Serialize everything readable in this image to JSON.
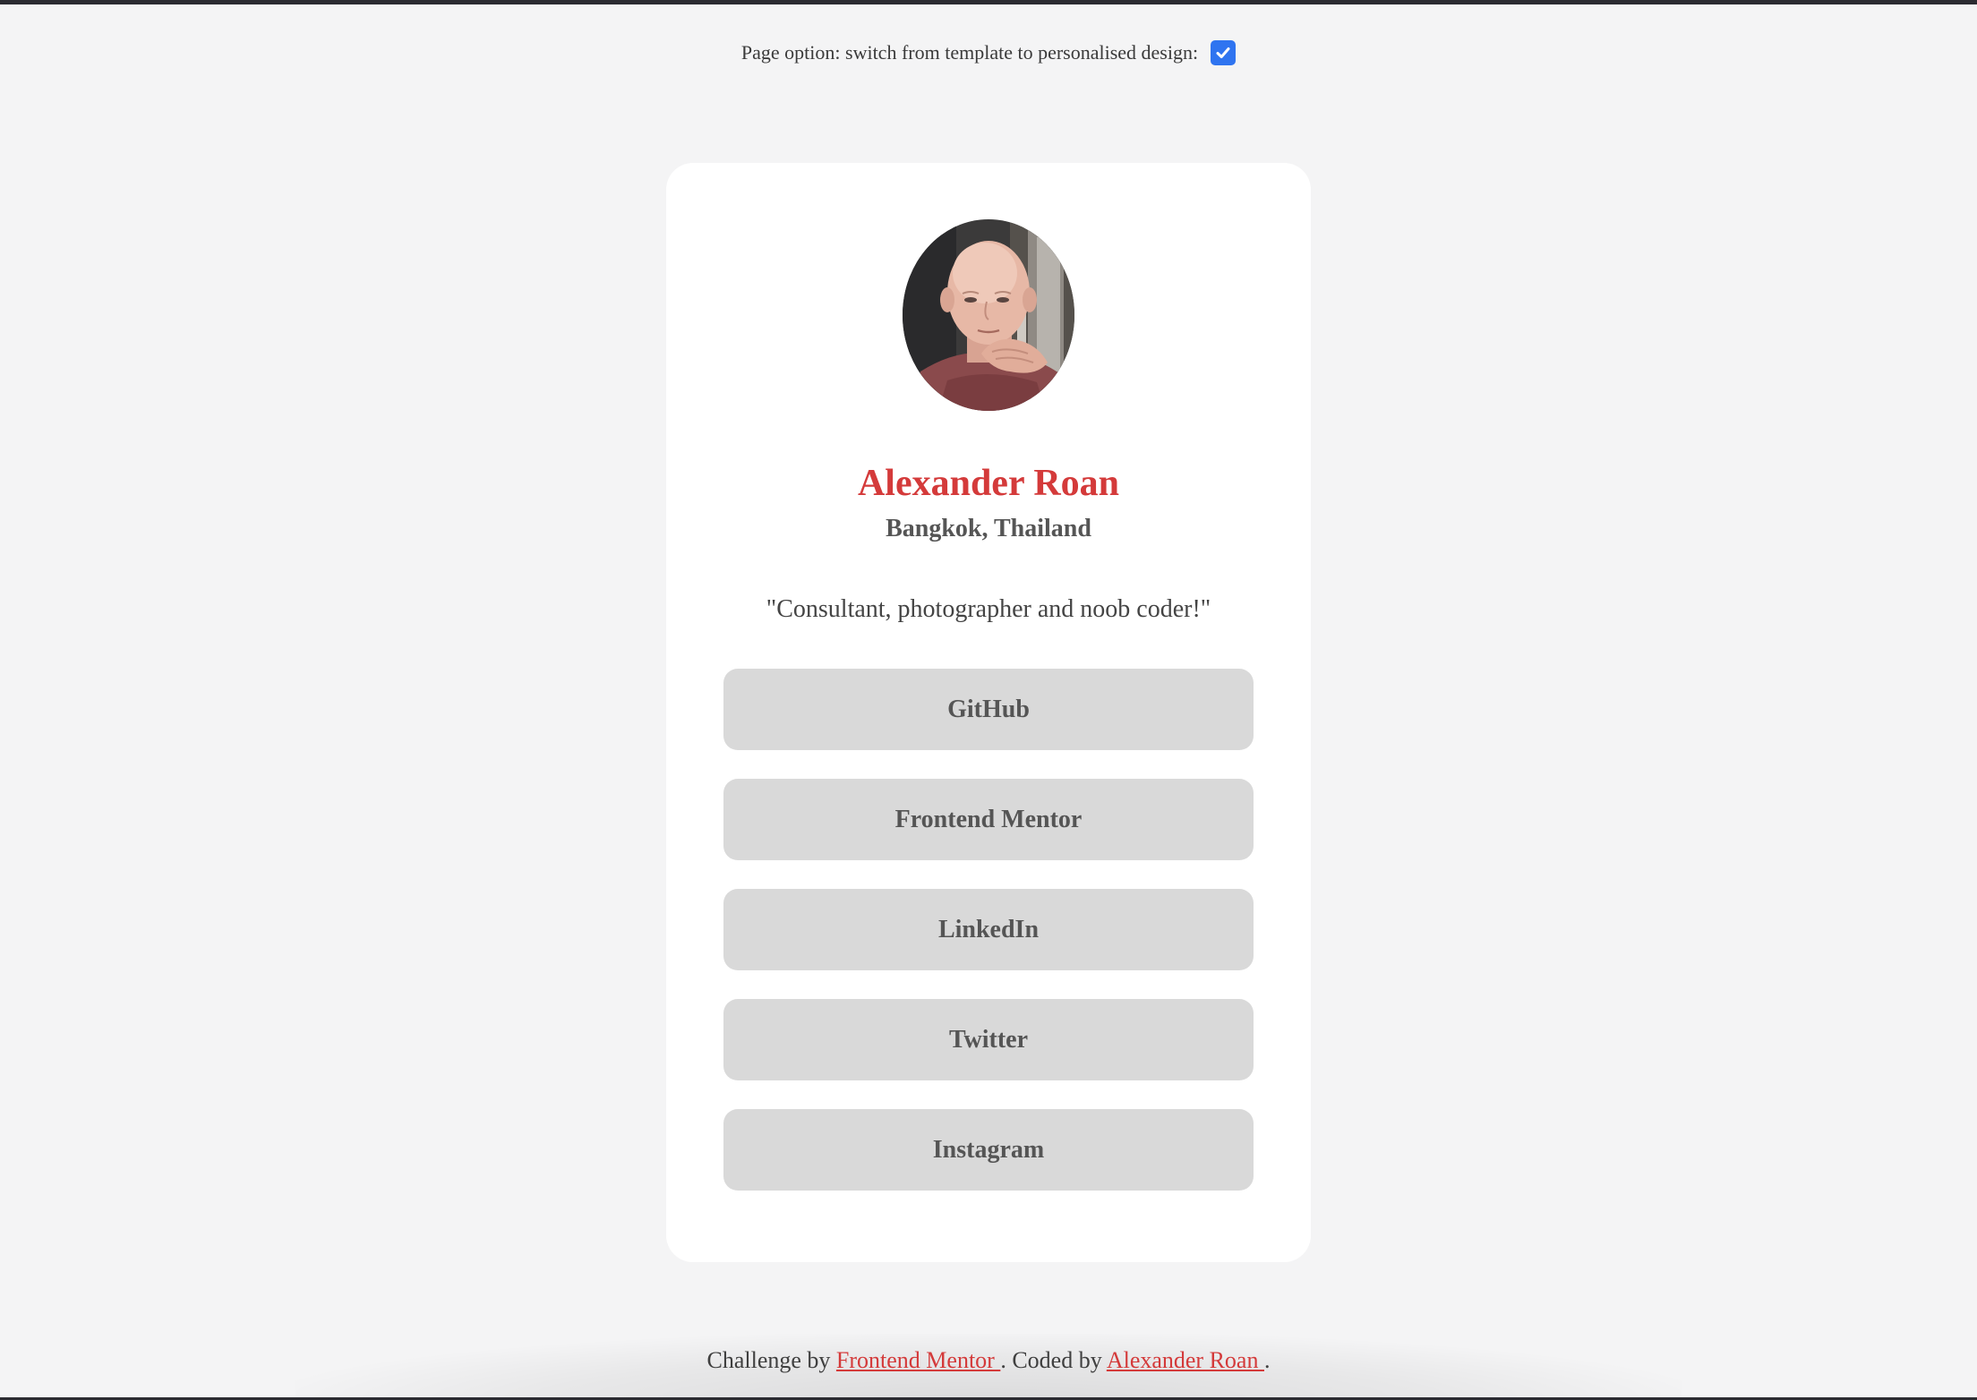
{
  "page_option": {
    "label": "Page option: switch from template to personalised design:",
    "checked": true
  },
  "profile": {
    "name": "Alexander Roan",
    "location": "Bangkok, Thailand",
    "bio": "\"Consultant, photographer and noob coder!\""
  },
  "links": [
    {
      "label": "GitHub"
    },
    {
      "label": "Frontend Mentor"
    },
    {
      "label": "LinkedIn"
    },
    {
      "label": "Twitter"
    },
    {
      "label": "Instagram"
    }
  ],
  "footer": {
    "prefix": "Challenge by",
    "challenge_link": "Frontend Mentor ",
    "middle": ". Coded by",
    "author_link": "Alexander Roan ",
    "suffix": "."
  },
  "colors": {
    "accent": "#d43a3a",
    "button_bg": "#d9d9d9",
    "page_bg": "#f4f4f5",
    "checkbox": "#2f74f0"
  }
}
